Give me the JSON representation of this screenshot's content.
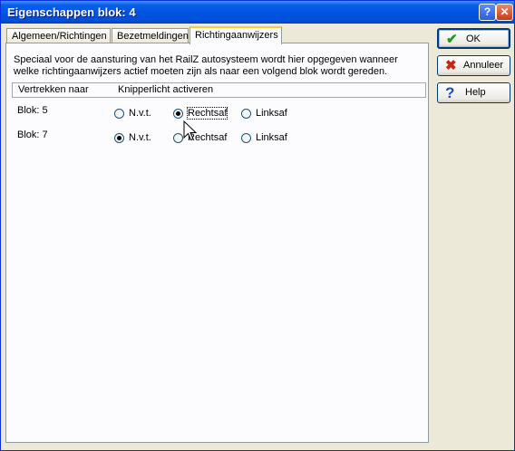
{
  "window": {
    "title": "Eigenschappen blok: 4"
  },
  "titlebar_buttons": {
    "help": "?",
    "close": "✕"
  },
  "tabs": [
    {
      "label": "Algemeen/Richtingen",
      "active": false
    },
    {
      "label": "Bezetmeldingen",
      "active": false
    },
    {
      "label": "Richtingaanwijzers",
      "active": true
    }
  ],
  "description": "Speciaal voor de aansturing van het RailZ autosysteem wordt hier opgegeven wanneer welke richtingaanwijzers actief moeten zijn als naar een volgend blok wordt gereden.",
  "list": {
    "columns": [
      "Vertrekken naar",
      "Knipperlicht activeren"
    ],
    "rows": [
      {
        "label": "Blok: 5",
        "options": [
          "N.v.t.",
          "Rechtsaf",
          "Linksaf"
        ],
        "selected": "Rechtsaf"
      },
      {
        "label": "Blok: 7",
        "options": [
          "N.v.t.",
          "Rechtsaf",
          "Linksaf"
        ],
        "selected": "N.v.t."
      }
    ]
  },
  "buttons": {
    "ok": {
      "label": "OK",
      "icon": "checkmark-icon",
      "color": "#1a9a1a"
    },
    "annuleer": {
      "label": "Annuleer",
      "icon": "x-icon",
      "color": "#c0281a"
    },
    "help": {
      "label": "Help",
      "icon": "question-icon",
      "color": "#1a4fc0"
    }
  }
}
